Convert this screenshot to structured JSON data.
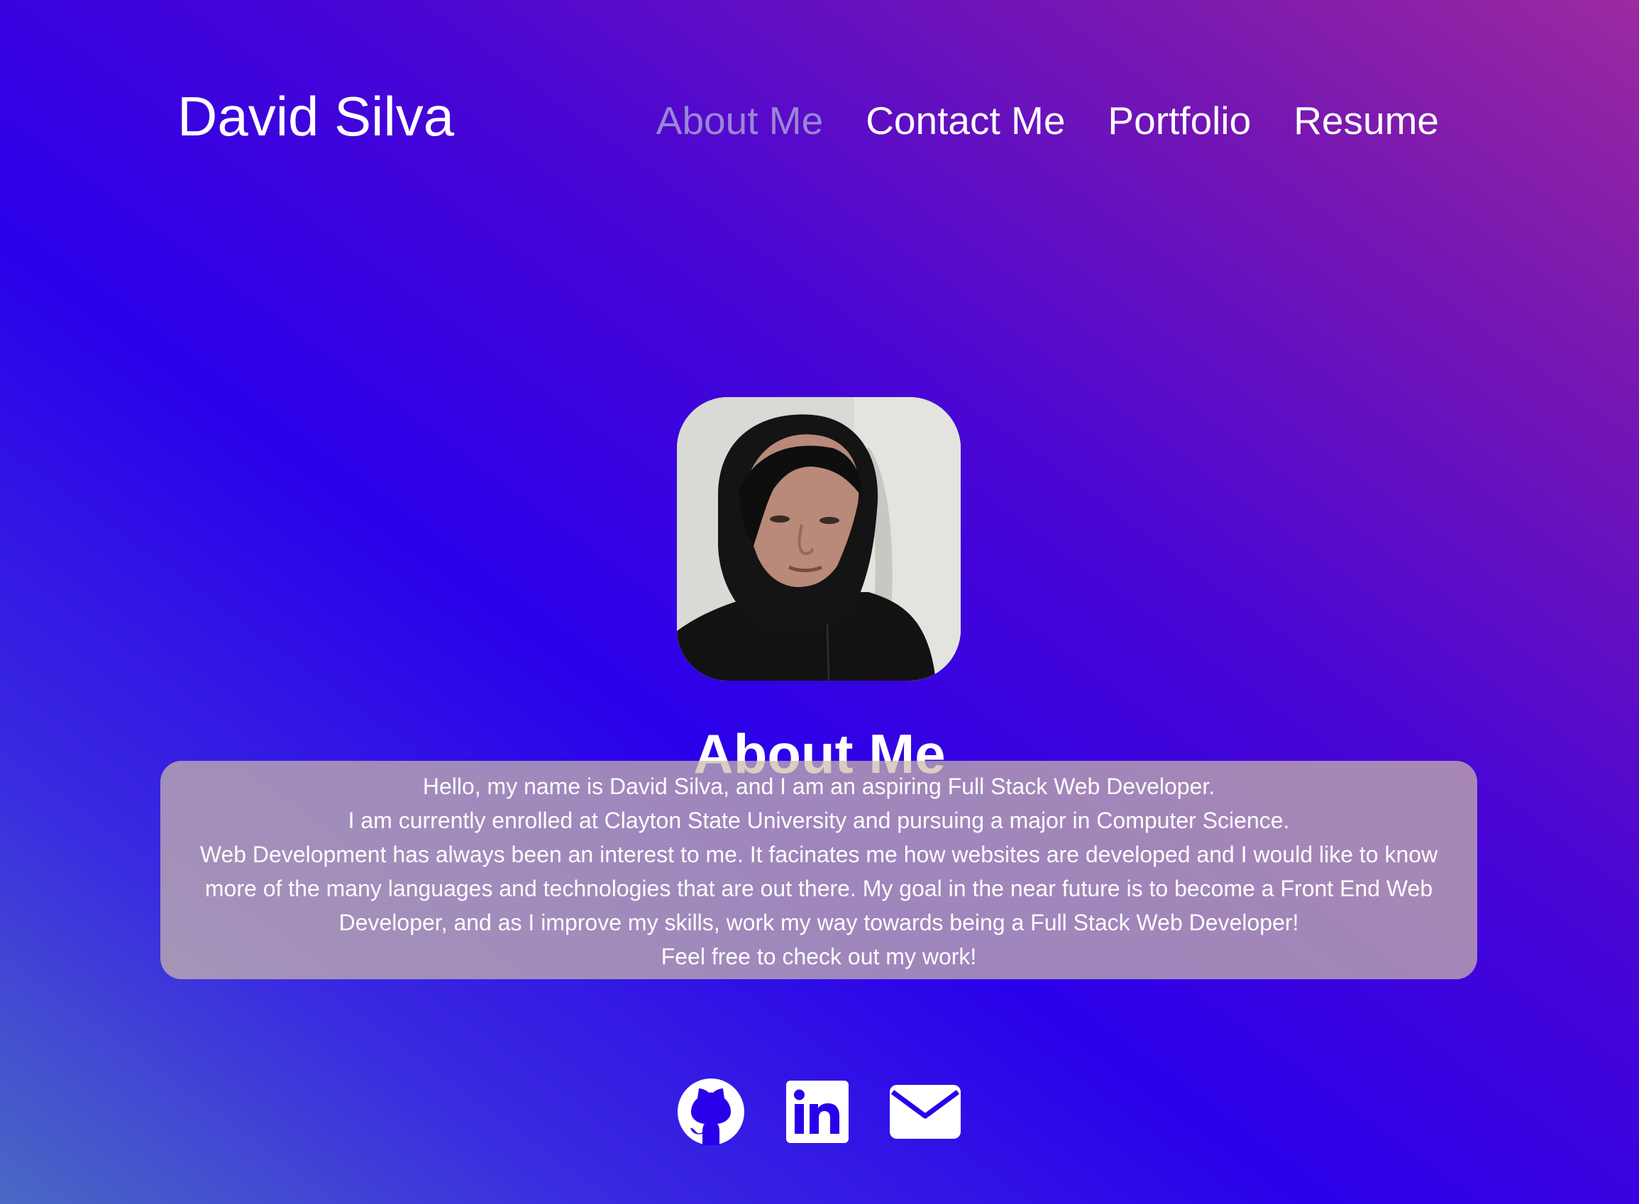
{
  "header": {
    "brand": "David Silva",
    "nav": [
      {
        "label": "About Me",
        "active": true
      },
      {
        "label": "Contact Me",
        "active": false
      },
      {
        "label": "Portfolio",
        "active": false
      },
      {
        "label": "Resume",
        "active": false
      }
    ]
  },
  "profile": {
    "photo_icon": "profile-photo",
    "title": "About Me",
    "paragraphs": [
      "Hello, my name is David Silva, and I am an aspiring Full Stack Web Developer.",
      "I am currently enrolled at Clayton State University and pursuing a major in Computer Science.",
      "Web Development has always been an interest to me. It facinates me how websites are developed and I would like to know more of the many languages and technologies that are out there. My goal in the near future is to become a Front End Web Developer, and as I improve my skills, work my way towards being a Full Stack Web Developer!",
      "Feel free to check out my work!"
    ]
  },
  "social": [
    {
      "icon": "github-icon"
    },
    {
      "icon": "linkedin-icon"
    },
    {
      "icon": "email-icon"
    }
  ],
  "colors": {
    "text": "#ffffff",
    "nav_active": "#9a86d6",
    "card_background": "#ccbaaa",
    "gradient_blue": "#2a00ea",
    "gradient_magenta": "#9c2aa0"
  }
}
